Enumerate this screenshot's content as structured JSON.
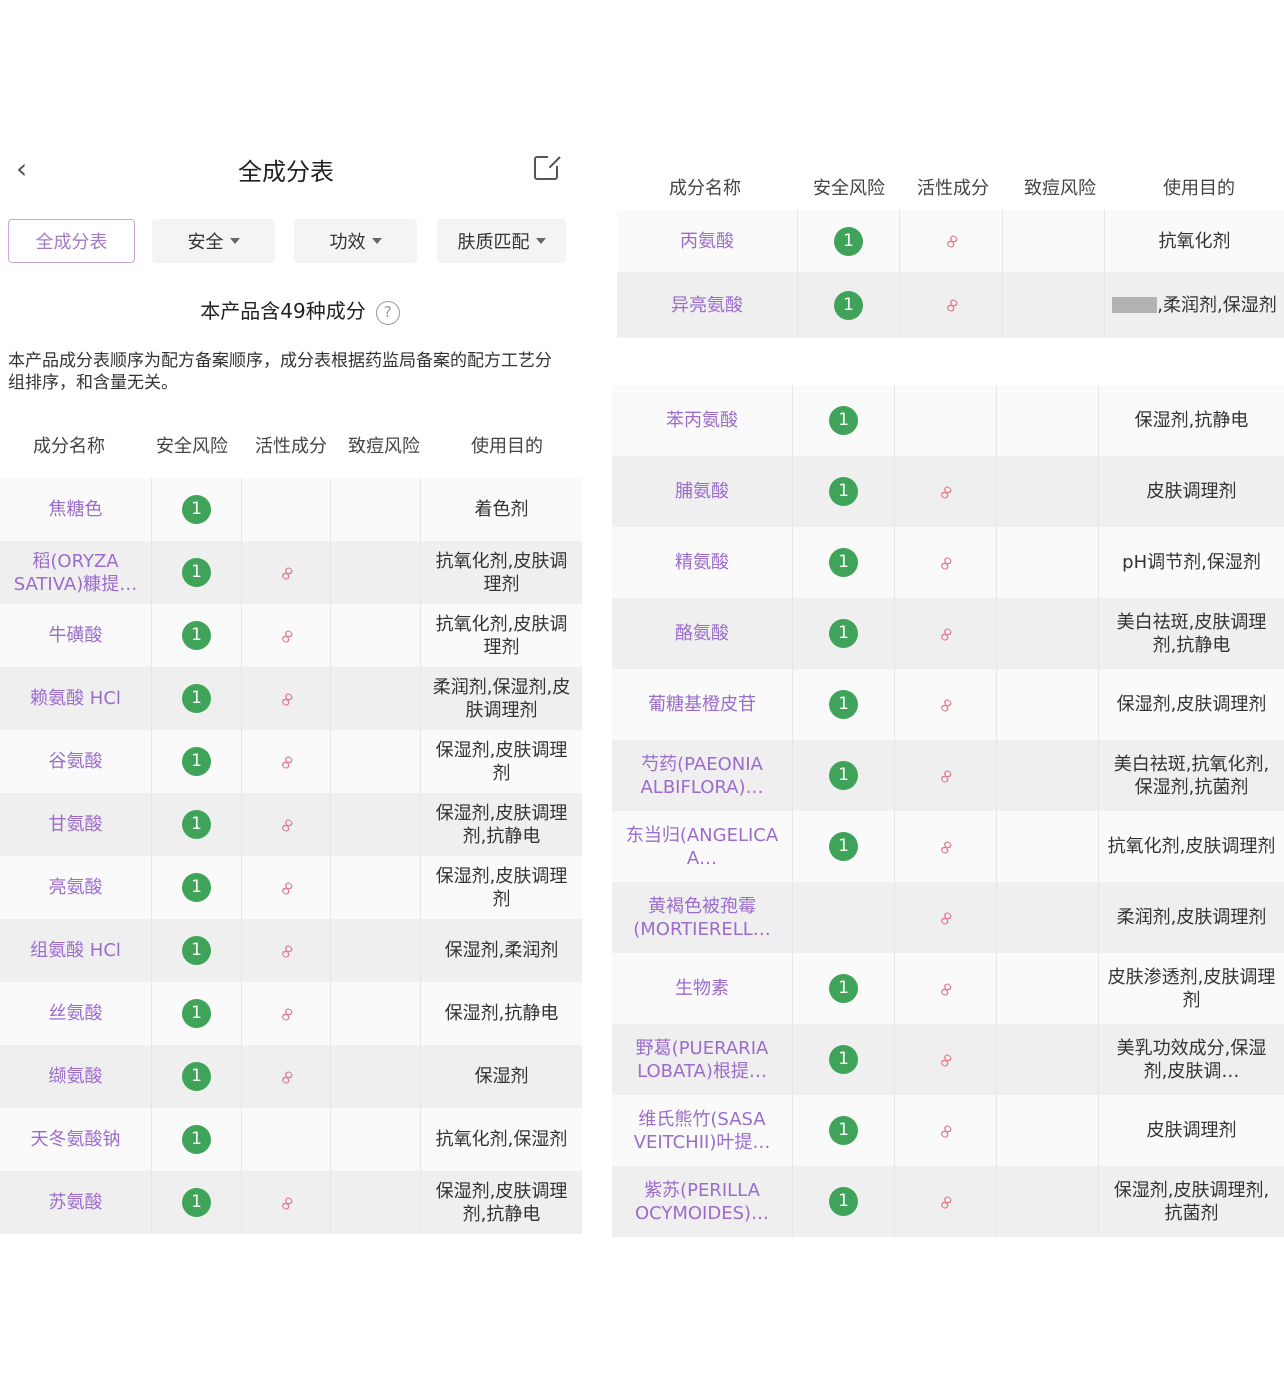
{
  "header": {
    "title": "全成分表",
    "back_icon": "‹"
  },
  "tabs": [
    {
      "label": "全成分表",
      "active": true
    },
    {
      "label": "安全",
      "dropdown": true
    },
    {
      "label": "功效",
      "dropdown": true
    },
    {
      "label": "肤质匹配",
      "dropdown": true
    }
  ],
  "summary": {
    "count_text": "本产品含49种成分",
    "help": "?"
  },
  "note": "本产品成分表顺序为配方备案顺序，成分表根据药监局备案的配方工艺分组排序，和含量无关。",
  "columns": [
    "成分名称",
    "安全风险",
    "活性成分",
    "致痘风险",
    "使用目的"
  ],
  "colors": {
    "name": "#9b6ccc",
    "badge": "#3fa45a",
    "active": "#e07a8e"
  },
  "left_rows": [
    {
      "name": "焦糖色",
      "risk": "1",
      "active": false,
      "purpose": "着色剂"
    },
    {
      "name": "稻(ORYZA SATIVA)糠提…",
      "risk": "1",
      "active": true,
      "purpose": "抗氧化剂,皮肤调理剂"
    },
    {
      "name": "牛磺酸",
      "risk": "1",
      "active": true,
      "purpose": "抗氧化剂,皮肤调理剂"
    },
    {
      "name": "赖氨酸 HCl",
      "risk": "1",
      "active": true,
      "purpose": "柔润剂,保湿剂,皮肤调理剂"
    },
    {
      "name": "谷氨酸",
      "risk": "1",
      "active": true,
      "purpose": "保湿剂,皮肤调理剂"
    },
    {
      "name": "甘氨酸",
      "risk": "1",
      "active": true,
      "purpose": "保湿剂,皮肤调理剂,抗静电"
    },
    {
      "name": "亮氨酸",
      "risk": "1",
      "active": true,
      "purpose": "保湿剂,皮肤调理剂"
    },
    {
      "name": "组氨酸 HCl",
      "risk": "1",
      "active": true,
      "purpose": "保湿剂,柔润剂"
    },
    {
      "name": "丝氨酸",
      "risk": "1",
      "active": true,
      "purpose": "保湿剂,抗静电"
    },
    {
      "name": "缬氨酸",
      "risk": "1",
      "active": true,
      "purpose": "保湿剂"
    },
    {
      "name": "天冬氨酸钠",
      "risk": "1",
      "active": false,
      "purpose": "抗氧化剂,保湿剂"
    },
    {
      "name": "苏氨酸",
      "risk": "1",
      "active": true,
      "purpose": "保湿剂,皮肤调理剂,抗静电"
    }
  ],
  "right_top_rows": [
    {
      "name": "丙氨酸",
      "risk": "1",
      "active": true,
      "purpose": "抗氧化剂"
    },
    {
      "name": "异亮氨酸",
      "risk": "1",
      "active": true,
      "purpose": ",柔润剂,保湿剂"
    }
  ],
  "right_rows": [
    {
      "name": "苯丙氨酸",
      "risk": "1",
      "active": false,
      "purpose": "保湿剂,抗静电"
    },
    {
      "name": "脯氨酸",
      "risk": "1",
      "active": true,
      "purpose": "皮肤调理剂"
    },
    {
      "name": "精氨酸",
      "risk": "1",
      "active": true,
      "purpose": "pH调节剂,保湿剂"
    },
    {
      "name": "酪氨酸",
      "risk": "1",
      "active": true,
      "purpose": "美白祛斑,皮肤调理剂,抗静电"
    },
    {
      "name": "葡糖基橙皮苷",
      "risk": "1",
      "active": true,
      "purpose": "保湿剂,皮肤调理剂"
    },
    {
      "name": "芍药(PAEONIA ALBIFLORA)…",
      "risk": "1",
      "active": true,
      "purpose": "美白祛斑,抗氧化剂,保湿剂,抗菌剂"
    },
    {
      "name": "东当归(ANGELICA A…",
      "risk": "1",
      "active": true,
      "purpose": "抗氧化剂,皮肤调理剂"
    },
    {
      "name": "黄褐色被孢霉(MORTIERELL…",
      "risk": "",
      "active": true,
      "purpose": "柔润剂,皮肤调理剂"
    },
    {
      "name": "生物素",
      "risk": "1",
      "active": true,
      "purpose": "皮肤渗透剂,皮肤调理剂"
    },
    {
      "name": "野葛(PUERARIA LOBATA)根提…",
      "risk": "1",
      "active": true,
      "purpose": "美乳功效成分,保湿剂,皮肤调…"
    },
    {
      "name": "维氏熊竹(SASA VEITCHII)叶提…",
      "risk": "1",
      "active": true,
      "purpose": "皮肤调理剂"
    },
    {
      "name": "紫苏(PERILLA OCYMOIDES)…",
      "risk": "1",
      "active": true,
      "purpose": "保湿剂,皮肤调理剂,抗菌剂"
    }
  ]
}
